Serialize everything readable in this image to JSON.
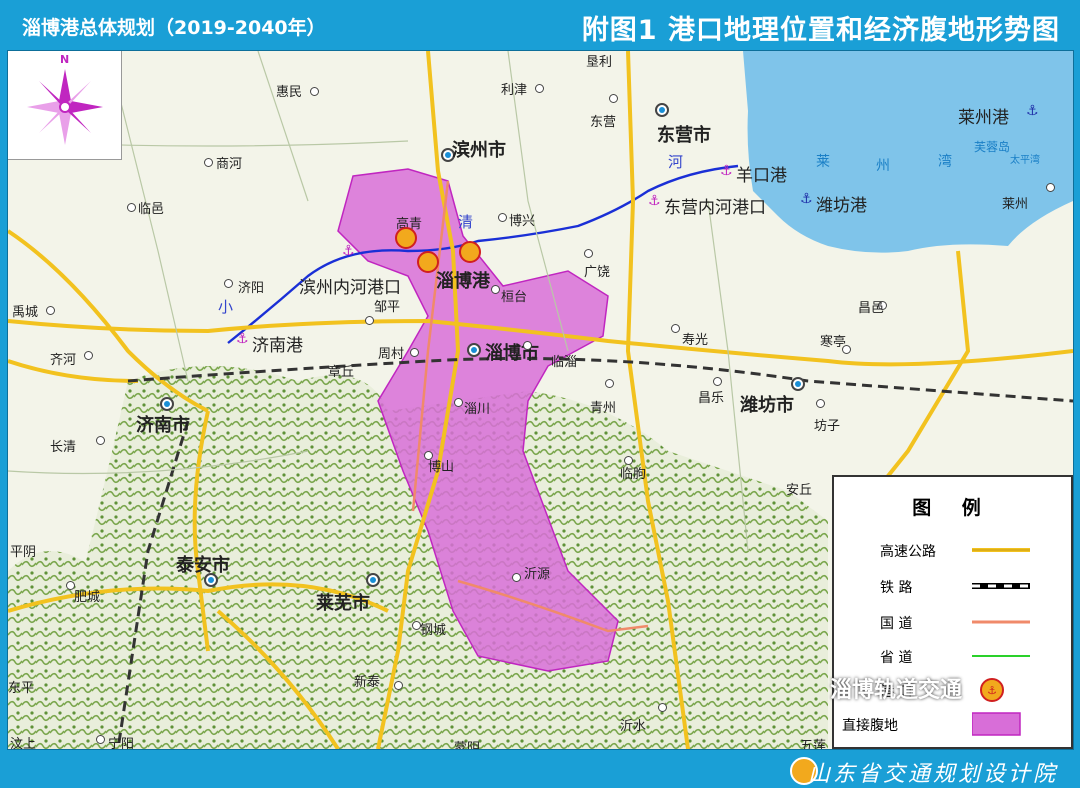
{
  "header": {
    "left_title": "淄博港总体规划（2019-2040年）",
    "right_title": "附图1  港口地理位置和经济腹地形势图"
  },
  "footer": {
    "org": "山东省交通规划设计院"
  },
  "watermark": "淄博轨道交通",
  "compass": {
    "north": "N",
    "icon": "compass-rose-icon"
  },
  "colors": {
    "expressway": "#f2c21f",
    "railway": "#000000",
    "national_road": "#f08a6a",
    "provincial_road": "#2ad12a",
    "hinterland": "#d86ed8",
    "river": "#1a2fd6",
    "sea": "#7fc4ea",
    "port": "#f2a91d",
    "header": "#1a9fd6"
  },
  "map": {
    "cities": {
      "jinan": "济南市",
      "zibo": "淄博市",
      "binzhou": "滨州市",
      "dongying": "东营市",
      "weifang": "潍坊市",
      "taian": "泰安市",
      "laiwu": "莱芜市"
    },
    "towns": {
      "kenli": "垦利",
      "huimin": "惠民",
      "lijin": "利津",
      "dongying_town": "东营",
      "shanghe": "商河",
      "linyi_town": "临邑",
      "gaoqing": "高青",
      "boxing": "博兴",
      "guangrao": "广饶",
      "jiyang": "济阳",
      "zouping": "邹平",
      "huantai": "桓台",
      "yucheng": "禹城",
      "qihe": "齐河",
      "zhangqiu": "章丘",
      "zhoucun": "周村",
      "linzi": "临淄",
      "shouguang": "寿光",
      "changyi": "昌邑",
      "hanting": "寒亭",
      "qingzhou": "青州",
      "changle": "昌乐",
      "zichuan": "淄川",
      "fangzi": "坊子",
      "changqing": "长清",
      "boshan": "博山",
      "linqu": "临朐",
      "anqiu": "安丘",
      "pingyin": "平阴",
      "yiyuan": "沂源",
      "feicheng": "肥城",
      "gangcheng": "钢城",
      "xintai": "新泰",
      "dongping": "东平",
      "yishui": "沂水",
      "wenshang": "汶上",
      "ningyang": "宁阳",
      "mengyin": "蒙阴",
      "wulian": "五莲",
      "laizhou": "莱州",
      "furong_island": "芙蓉岛",
      "taiping_bay": "太平湾"
    },
    "ports": {
      "zibo_port": "淄博港",
      "binzhou_inland": "滨州内河港口",
      "jinan_port": "济南港",
      "yangkou": "羊口港",
      "dongying_inland": "东营内河港口",
      "weifang_port": "潍坊港",
      "laizhou_port": "莱州港"
    },
    "river_text": [
      "小",
      "清",
      "河"
    ],
    "sea_text": [
      "莱",
      "州",
      "湾"
    ]
  },
  "legend": {
    "title": "图  例",
    "items": [
      {
        "label": "高速公路",
        "symbol": "expressway-line-icon"
      },
      {
        "label": "铁  路",
        "symbol": "railway-line-icon"
      },
      {
        "label": "国  道",
        "symbol": "national-road-line-icon"
      },
      {
        "label": "省  道",
        "symbol": "provincial-road-line-icon"
      },
      {
        "label": "港  口",
        "symbol": "port-icon"
      },
      {
        "label": "直接腹地",
        "symbol": "hinterland-area-icon"
      }
    ]
  }
}
